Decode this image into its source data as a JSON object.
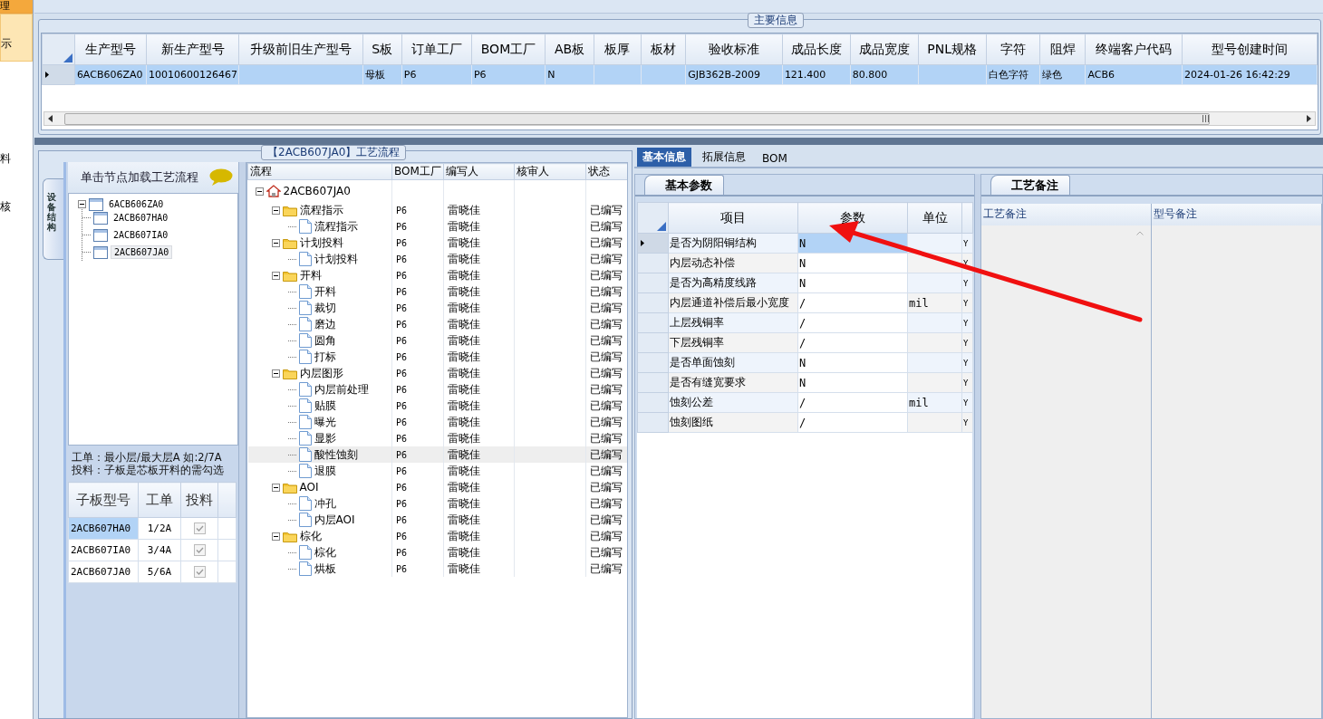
{
  "sidebar": {
    "items": [
      {
        "label": "理",
        "selected": true
      },
      {
        "label": "示",
        "selected": false,
        "hovered": true
      },
      {
        "label": "料",
        "selected": false,
        "hovered": false
      },
      {
        "label": "核",
        "selected": false,
        "hovered": false
      }
    ]
  },
  "main_info": {
    "title": "主要信息",
    "columns": [
      "生产型号",
      "新生产型号",
      "升级前旧生产型号",
      "S板",
      "订单工厂",
      "BOM工厂",
      "AB板",
      "板厚",
      "板材",
      "验收标准",
      "成品长度",
      "成品宽度",
      "PNL规格",
      "字符",
      "阻焊",
      "终端客户代码",
      "型号创建时间"
    ],
    "rows": [
      {
        "selected": true,
        "cells": [
          "6ACB606ZA0",
          "10010600126467",
          "",
          "母板",
          "P6",
          "P6",
          "N",
          "",
          "",
          "GJB362B-2009",
          "121.400",
          "80.800",
          "",
          "白色字符",
          "绿色",
          "ACB6",
          "2024-01-26 16:42:29"
        ]
      }
    ]
  },
  "process": {
    "title": "【2ACB607JA0】工艺流程",
    "side_tab": "设备结构",
    "tree_header": "单击节点加载工艺流程",
    "structure_tree": {
      "label": "6ACB606ZA0",
      "expanded": true,
      "selected": false,
      "children": [
        {
          "label": "2ACB607HA0",
          "selected": false
        },
        {
          "label": "2ACB607IA0",
          "selected": false
        },
        {
          "label": "2ACB607JA0",
          "selected": true
        }
      ]
    },
    "note": [
      "工单：最小层/最大层A 如:2/7A",
      "投料：子板是芯板开料的需勾选"
    ],
    "sub_table": {
      "columns": [
        "子板型号",
        "工单",
        "投料"
      ],
      "rows": [
        {
          "model": "2ACB607HA0",
          "order": "1/2A",
          "feed": true,
          "selected": true
        },
        {
          "model": "2ACB607IA0",
          "order": "3/4A",
          "feed": true,
          "selected": false
        },
        {
          "model": "2ACB607JA0",
          "order": "5/6A",
          "feed": true,
          "selected": false
        }
      ]
    },
    "flow": {
      "columns": [
        "流程",
        "BOM工厂",
        "编写人",
        "核审人",
        "状态"
      ],
      "root": {
        "label": "2ACB607JA0",
        "kind": "root",
        "expanded": true,
        "children": [
          {
            "label": "流程指示",
            "kind": "folder",
            "expanded": true,
            "bom": "P6",
            "writer": "雷晓佳",
            "status": "已编写",
            "children": [
              {
                "label": "流程指示",
                "kind": "step",
                "bom": "P6",
                "writer": "雷晓佳",
                "status": "已编写",
                "selected": false
              }
            ]
          },
          {
            "label": "计划投料",
            "kind": "folder",
            "expanded": true,
            "bom": "P6",
            "writer": "雷晓佳",
            "status": "已编写",
            "children": [
              {
                "label": "计划投料",
                "kind": "step",
                "bom": "P6",
                "writer": "雷晓佳",
                "status": "已编写",
                "selected": false
              }
            ]
          },
          {
            "label": "开料",
            "kind": "folder",
            "expanded": true,
            "bom": "P6",
            "writer": "雷晓佳",
            "status": "已编写",
            "children": [
              {
                "label": "开料",
                "kind": "step",
                "bom": "P6",
                "writer": "雷晓佳",
                "status": "已编写",
                "selected": false
              },
              {
                "label": "裁切",
                "kind": "step",
                "bom": "P6",
                "writer": "雷晓佳",
                "status": "已编写",
                "selected": false
              },
              {
                "label": "磨边",
                "kind": "step",
                "bom": "P6",
                "writer": "雷晓佳",
                "status": "已编写",
                "selected": false
              },
              {
                "label": "圆角",
                "kind": "step",
                "bom": "P6",
                "writer": "雷晓佳",
                "status": "已编写",
                "selected": false
              },
              {
                "label": "打标",
                "kind": "step",
                "bom": "P6",
                "writer": "雷晓佳",
                "status": "已编写",
                "selected": false
              }
            ]
          },
          {
            "label": "内层图形",
            "kind": "folder",
            "expanded": true,
            "bom": "P6",
            "writer": "雷晓佳",
            "status": "已编写",
            "children": [
              {
                "label": "内层前处理",
                "kind": "step",
                "bom": "P6",
                "writer": "雷晓佳",
                "status": "已编写",
                "selected": false
              },
              {
                "label": "贴膜",
                "kind": "step",
                "bom": "P6",
                "writer": "雷晓佳",
                "status": "已编写",
                "selected": false
              },
              {
                "label": "曝光",
                "kind": "step",
                "bom": "P6",
                "writer": "雷晓佳",
                "status": "已编写",
                "selected": false
              },
              {
                "label": "显影",
                "kind": "step",
                "bom": "P6",
                "writer": "雷晓佳",
                "status": "已编写",
                "selected": false
              },
              {
                "label": "酸性蚀刻",
                "kind": "step",
                "bom": "P6",
                "writer": "雷晓佳",
                "status": "已编写",
                "selected": true
              },
              {
                "label": "退膜",
                "kind": "step",
                "bom": "P6",
                "writer": "雷晓佳",
                "status": "已编写",
                "selected": false
              }
            ]
          },
          {
            "label": "AOI",
            "kind": "folder",
            "expanded": true,
            "bom": "P6",
            "writer": "雷晓佳",
            "status": "已编写",
            "children": [
              {
                "label": "冲孔",
                "kind": "step",
                "bom": "P6",
                "writer": "雷晓佳",
                "status": "已编写",
                "selected": false
              },
              {
                "label": "内层AOI",
                "kind": "step",
                "bom": "P6",
                "writer": "雷晓佳",
                "status": "已编写",
                "selected": false
              }
            ]
          },
          {
            "label": "棕化",
            "kind": "folder",
            "expanded": true,
            "bom": "P6",
            "writer": "雷晓佳",
            "status": "已编写",
            "children": [
              {
                "label": "棕化",
                "kind": "step",
                "bom": "P6",
                "writer": "雷晓佳",
                "status": "已编写",
                "selected": false
              },
              {
                "label": "烘板",
                "kind": "step",
                "bom": "P6",
                "writer": "雷晓佳",
                "status": "已编写",
                "selected": false
              }
            ]
          }
        ]
      }
    }
  },
  "detail": {
    "tabs": [
      {
        "label": "基本信息",
        "selected": true
      },
      {
        "label": "拓展信息",
        "selected": false
      },
      {
        "label": "BOM",
        "selected": false
      }
    ],
    "params": {
      "tab": "基本参数",
      "columns": [
        "项目",
        "参数",
        "单位"
      ],
      "rows": [
        {
          "item": "是否为阴阳铜结构",
          "value": "N",
          "unit": "",
          "flag": "Y",
          "selected": true
        },
        {
          "item": "内层动态补偿",
          "value": "N",
          "unit": "",
          "flag": "Y",
          "selected": false
        },
        {
          "item": "是否为高精度线路",
          "value": "N",
          "unit": "",
          "flag": "Y",
          "selected": false
        },
        {
          "item": "内层通道补偿后最小宽度",
          "value": "/",
          "unit": "mil",
          "flag": "Y",
          "selected": false
        },
        {
          "item": "上层残铜率",
          "value": "/",
          "unit": "",
          "flag": "Y",
          "selected": false
        },
        {
          "item": "下层残铜率",
          "value": "/",
          "unit": "",
          "flag": "Y",
          "selected": false
        },
        {
          "item": "是否单面蚀刻",
          "value": "N",
          "unit": "",
          "flag": "Y",
          "selected": false
        },
        {
          "item": "是否有缝宽要求",
          "value": "N",
          "unit": "",
          "flag": "Y",
          "selected": false
        },
        {
          "item": "蚀刻公差",
          "value": "/",
          "unit": "mil",
          "flag": "Y",
          "selected": false
        },
        {
          "item": "蚀刻图纸",
          "value": "/",
          "unit": "",
          "flag": "Y",
          "selected": false
        }
      ]
    },
    "remarks": {
      "tab": "工艺备注",
      "columns": [
        "工艺备注",
        "型号备注"
      ]
    }
  }
}
